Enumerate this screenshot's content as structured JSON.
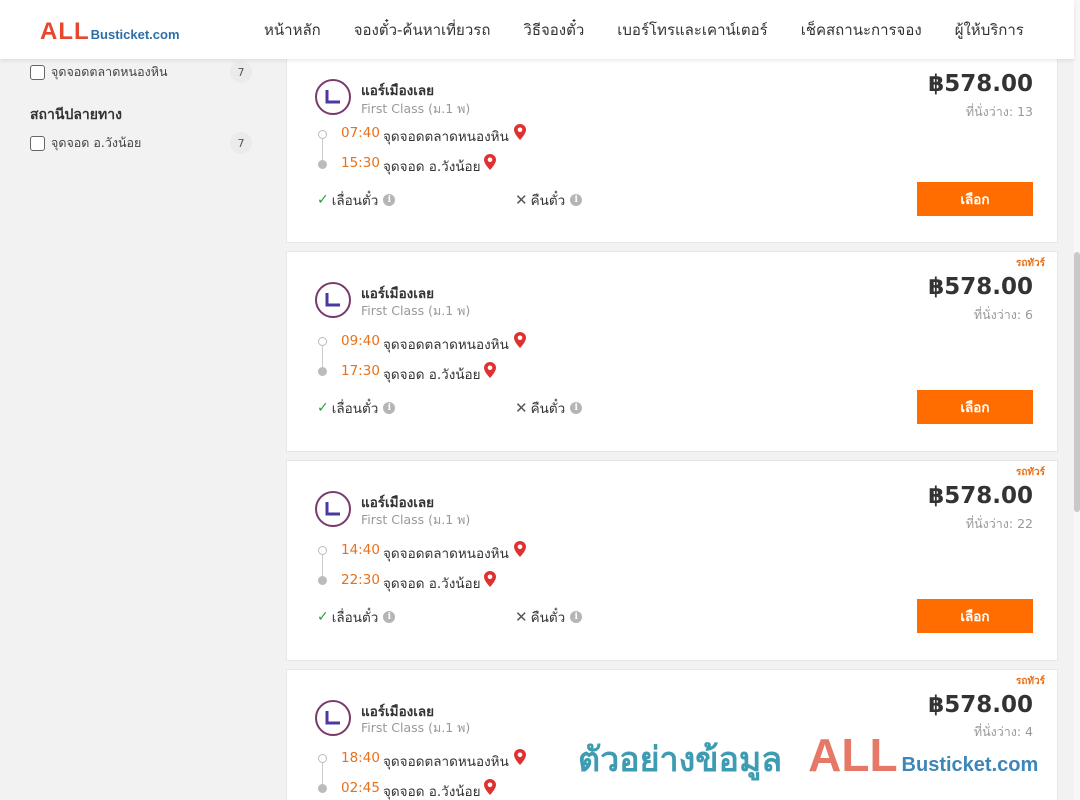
{
  "header": {
    "logo_all": "ALL",
    "logo_rest": "Busticket.com",
    "nav": [
      "หน้าหลัก",
      "จองตั๋ว-ค้นหาเที่ยวรถ",
      "วิธีจองตั๋ว",
      "เบอร์โทรและเคาน์เตอร์",
      "เช็คสถานะการจอง",
      "ผู้ให้บริการ"
    ]
  },
  "sidebar": {
    "origin_option": {
      "label": "จุดจอดตลาดหนองหิน",
      "count": "7"
    },
    "destination_title": "สถานีปลายทาง",
    "destination_option": {
      "label": "จุดจอด อ.วังน้อย",
      "count": "7"
    }
  },
  "trips": [
    {
      "badge": "",
      "operator": "แอร์เมืองเลย",
      "class": "First Class (ม.1 พ)",
      "price": "฿578.00",
      "seats": "ที่นั่งว่าง: 13",
      "depart_time": "07:40",
      "depart_stop": "จุดจอดตลาดหนองหิน",
      "arrive_time": "15:30",
      "arrive_stop": "จุดจอด อ.วังน้อย",
      "feature_1": "เลื่อนตั๋ว",
      "feature_2": "คืนตั๋ว",
      "button": "เลือก"
    },
    {
      "badge": "รถทัวร์",
      "operator": "แอร์เมืองเลย",
      "class": "First Class (ม.1 พ)",
      "price": "฿578.00",
      "seats": "ที่นั่งว่าง: 6",
      "depart_time": "09:40",
      "depart_stop": "จุดจอดตลาดหนองหิน",
      "arrive_time": "17:30",
      "arrive_stop": "จุดจอด อ.วังน้อย",
      "feature_1": "เลื่อนตั๋ว",
      "feature_2": "คืนตั๋ว",
      "button": "เลือก"
    },
    {
      "badge": "รถทัวร์",
      "operator": "แอร์เมืองเลย",
      "class": "First Class (ม.1 พ)",
      "price": "฿578.00",
      "seats": "ที่นั่งว่าง: 22",
      "depart_time": "14:40",
      "depart_stop": "จุดจอดตลาดหนองหิน",
      "arrive_time": "22:30",
      "arrive_stop": "จุดจอด อ.วังน้อย",
      "feature_1": "เลื่อนตั๋ว",
      "feature_2": "คืนตั๋ว",
      "button": "เลือก"
    },
    {
      "badge": "รถทัวร์",
      "operator": "แอร์เมืองเลย",
      "class": "First Class (ม.1 พ)",
      "price": "฿578.00",
      "seats": "ที่นั่งว่าง: 4",
      "depart_time": "18:40",
      "depart_stop": "จุดจอดตลาดหนองหิน",
      "arrive_time": "02:45",
      "arrive_stop": "จุดจอด อ.วังน้อย"
    }
  ],
  "watermark": {
    "text": "ตัวอย่างข้อมูล",
    "brand_all": "ALL",
    "brand_rest": "Busticket.com"
  },
  "colors": {
    "accent": "#ff6d00",
    "time": "#e8711a",
    "check": "#2a9d3a",
    "pin": "#e03030",
    "brand_red": "#e8472e",
    "brand_blue": "#2f6fa8"
  },
  "icons": {
    "origin_checkbox": "checkbox-icon",
    "pin": "map-pin-icon",
    "check": "check-icon",
    "cross": "cross-icon",
    "info": "info-icon",
    "operator": "operator-logo"
  }
}
